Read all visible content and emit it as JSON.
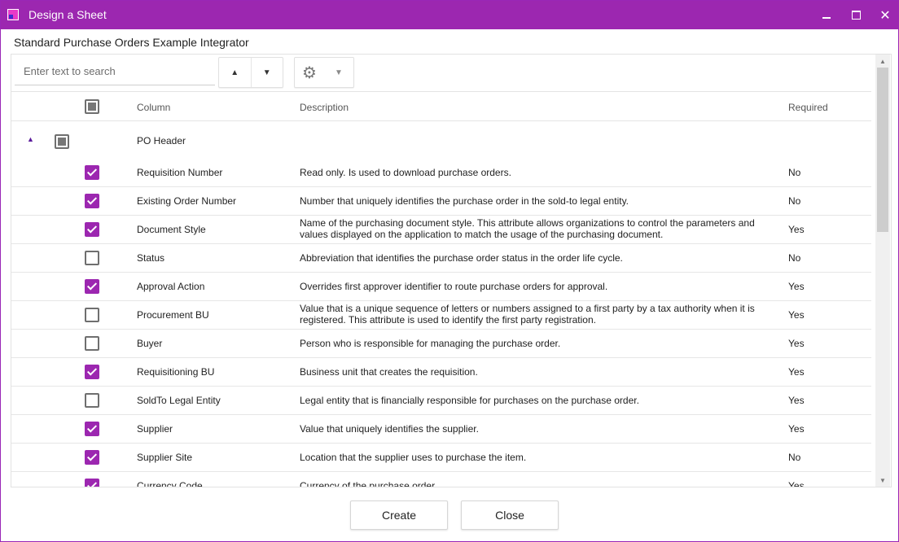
{
  "window": {
    "title": "Design a Sheet"
  },
  "subtitle": "Standard Purchase Orders Example Integrator",
  "search": {
    "placeholder": "Enter text to search",
    "value": ""
  },
  "header": {
    "column": "Column",
    "description": "Description",
    "required": "Required"
  },
  "group": {
    "label": "PO Header"
  },
  "rows": [
    {
      "column": "Requisition Number",
      "checked": true,
      "description": [
        "Read only. Is used to download purchase orders."
      ],
      "required": "No"
    },
    {
      "column": "Existing Order Number",
      "checked": true,
      "description": [
        "Number that uniquely identifies the purchase order in the sold-to legal entity."
      ],
      "required": "No"
    },
    {
      "column": "Document Style",
      "checked": true,
      "description": [
        "Name of the purchasing document style. This attribute allows organizations to control the parameters and",
        "values displayed on the application to match the usage of the purchasing document."
      ],
      "required": "Yes"
    },
    {
      "column": "Status",
      "checked": false,
      "description": [
        "Abbreviation that identifies the purchase order status in the order life cycle."
      ],
      "required": "No"
    },
    {
      "column": "Approval Action",
      "checked": true,
      "description": [
        "Overrides first approver identifier to route purchase orders for approval."
      ],
      "required": "Yes"
    },
    {
      "column": "Procurement BU",
      "checked": false,
      "description": [
        "Value that is a unique sequence of letters or numbers assigned to a first party by a tax authority when it is",
        "registered. This attribute is used to identify the first party registration."
      ],
      "required": "Yes"
    },
    {
      "column": "Buyer",
      "checked": false,
      "description": [
        "Person who is responsible for managing the purchase order."
      ],
      "required": "Yes"
    },
    {
      "column": "Requisitioning BU",
      "checked": true,
      "description": [
        "Business unit that creates the requisition."
      ],
      "required": "Yes"
    },
    {
      "column": "SoldTo Legal Entity",
      "checked": false,
      "description": [
        "Legal entity that is financially responsible for purchases on the purchase order."
      ],
      "required": "Yes"
    },
    {
      "column": "Supplier",
      "checked": true,
      "description": [
        "Value that uniquely identifies the supplier."
      ],
      "required": "Yes"
    },
    {
      "column": "Supplier Site",
      "checked": true,
      "description": [
        "Location that the supplier uses to purchase the item."
      ],
      "required": "No"
    },
    {
      "column": "Currency Code",
      "checked": true,
      "description": [
        "Currency of the purchase order."
      ],
      "required": "Yes"
    }
  ],
  "buttons": {
    "create": "Create",
    "close": "Close"
  },
  "icons": {
    "app": "app-icon",
    "minimize": "minimize-icon",
    "maximize": "maximize-icon",
    "close": "close-icon",
    "sort_up": "caret-up-icon",
    "sort_down": "caret-down-icon",
    "settings": "gear-icon",
    "settings_menu": "chevron-down-icon",
    "group_toggle": "collapse-triangle-icon"
  },
  "colors": {
    "accent": "#9c27b0",
    "titlebar": "#9c27b0",
    "toggle": "#5a1a9a"
  }
}
